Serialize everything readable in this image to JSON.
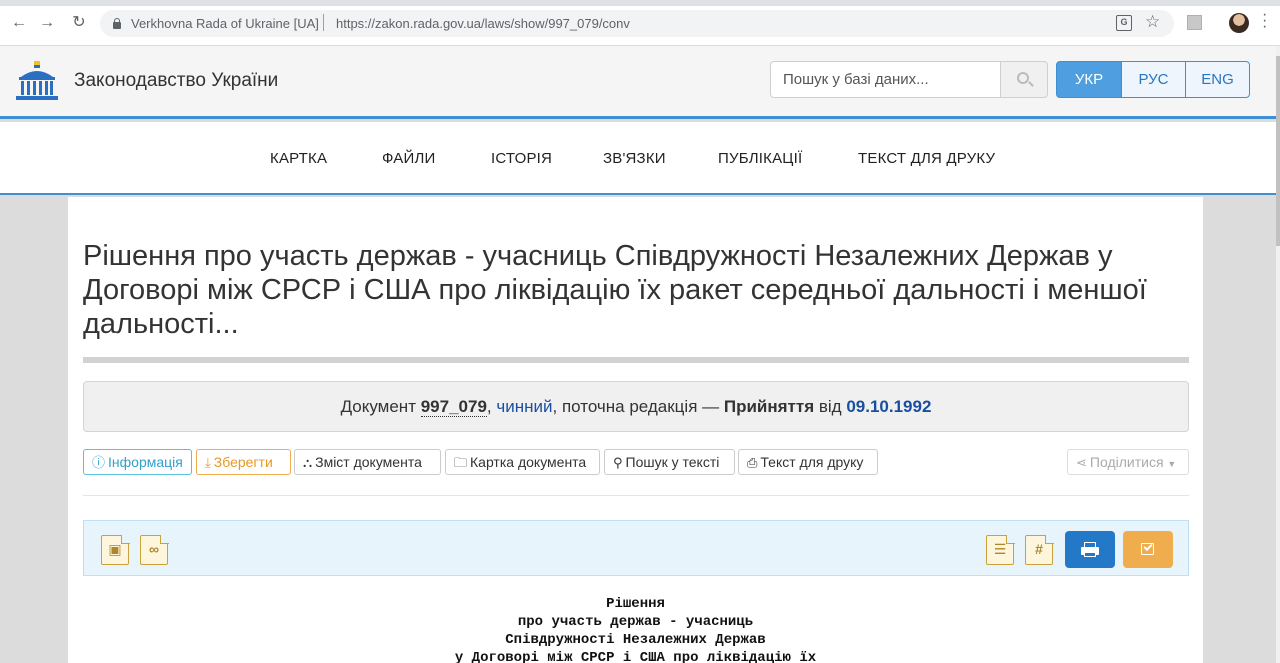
{
  "browser": {
    "site_name": "Verkhovna Rada of Ukraine [UA]",
    "url": "https://zakon.rada.gov.ua/laws/show/997_079/conv"
  },
  "header": {
    "site_title": "Законодавство України",
    "search_placeholder": "Пошук у базі даних...",
    "languages": [
      "УКР",
      "РУС",
      "ENG"
    ],
    "active_language": "УКР"
  },
  "nav": {
    "items": [
      "КАРТКА",
      "ФАЙЛИ",
      "ІСТОРІЯ",
      "ЗВ'ЯЗКИ",
      "ПУБЛІКАЦІЇ",
      "ТЕКСТ ДЛЯ ДРУКУ"
    ]
  },
  "document": {
    "title": "Рішення про участь держав - учасниць Співдружності Незалежних Держав у Договорі між СРСР і США про ліквідацію їх ракет середньої дальності і меншої дальності...",
    "info": {
      "prefix": "Документ",
      "code": "997_079",
      "comma1": ",",
      "status": "чинний",
      "edition": ", поточна редакція —",
      "adoption": "Прийняття",
      "from": "від",
      "date": "09.10.1992"
    },
    "tools": {
      "info": "Інформація",
      "save": "Зберегти",
      "contents": "Зміст документа",
      "card": "Картка документа",
      "search": "Пошук у тексті",
      "print": "Текст для друку",
      "share": "Поділитися"
    },
    "body_lines": [
      "Рішення",
      "про участь держав - учасниць",
      "Співдружності Незалежних Держав",
      "у Договорі між СРСР і США про ліквідацію їх"
    ]
  },
  "colors": {
    "accent": "#3f8fd2",
    "link": "#1a4fa0",
    "warning": "#f0ad4e",
    "primary_button": "#2478c8"
  }
}
